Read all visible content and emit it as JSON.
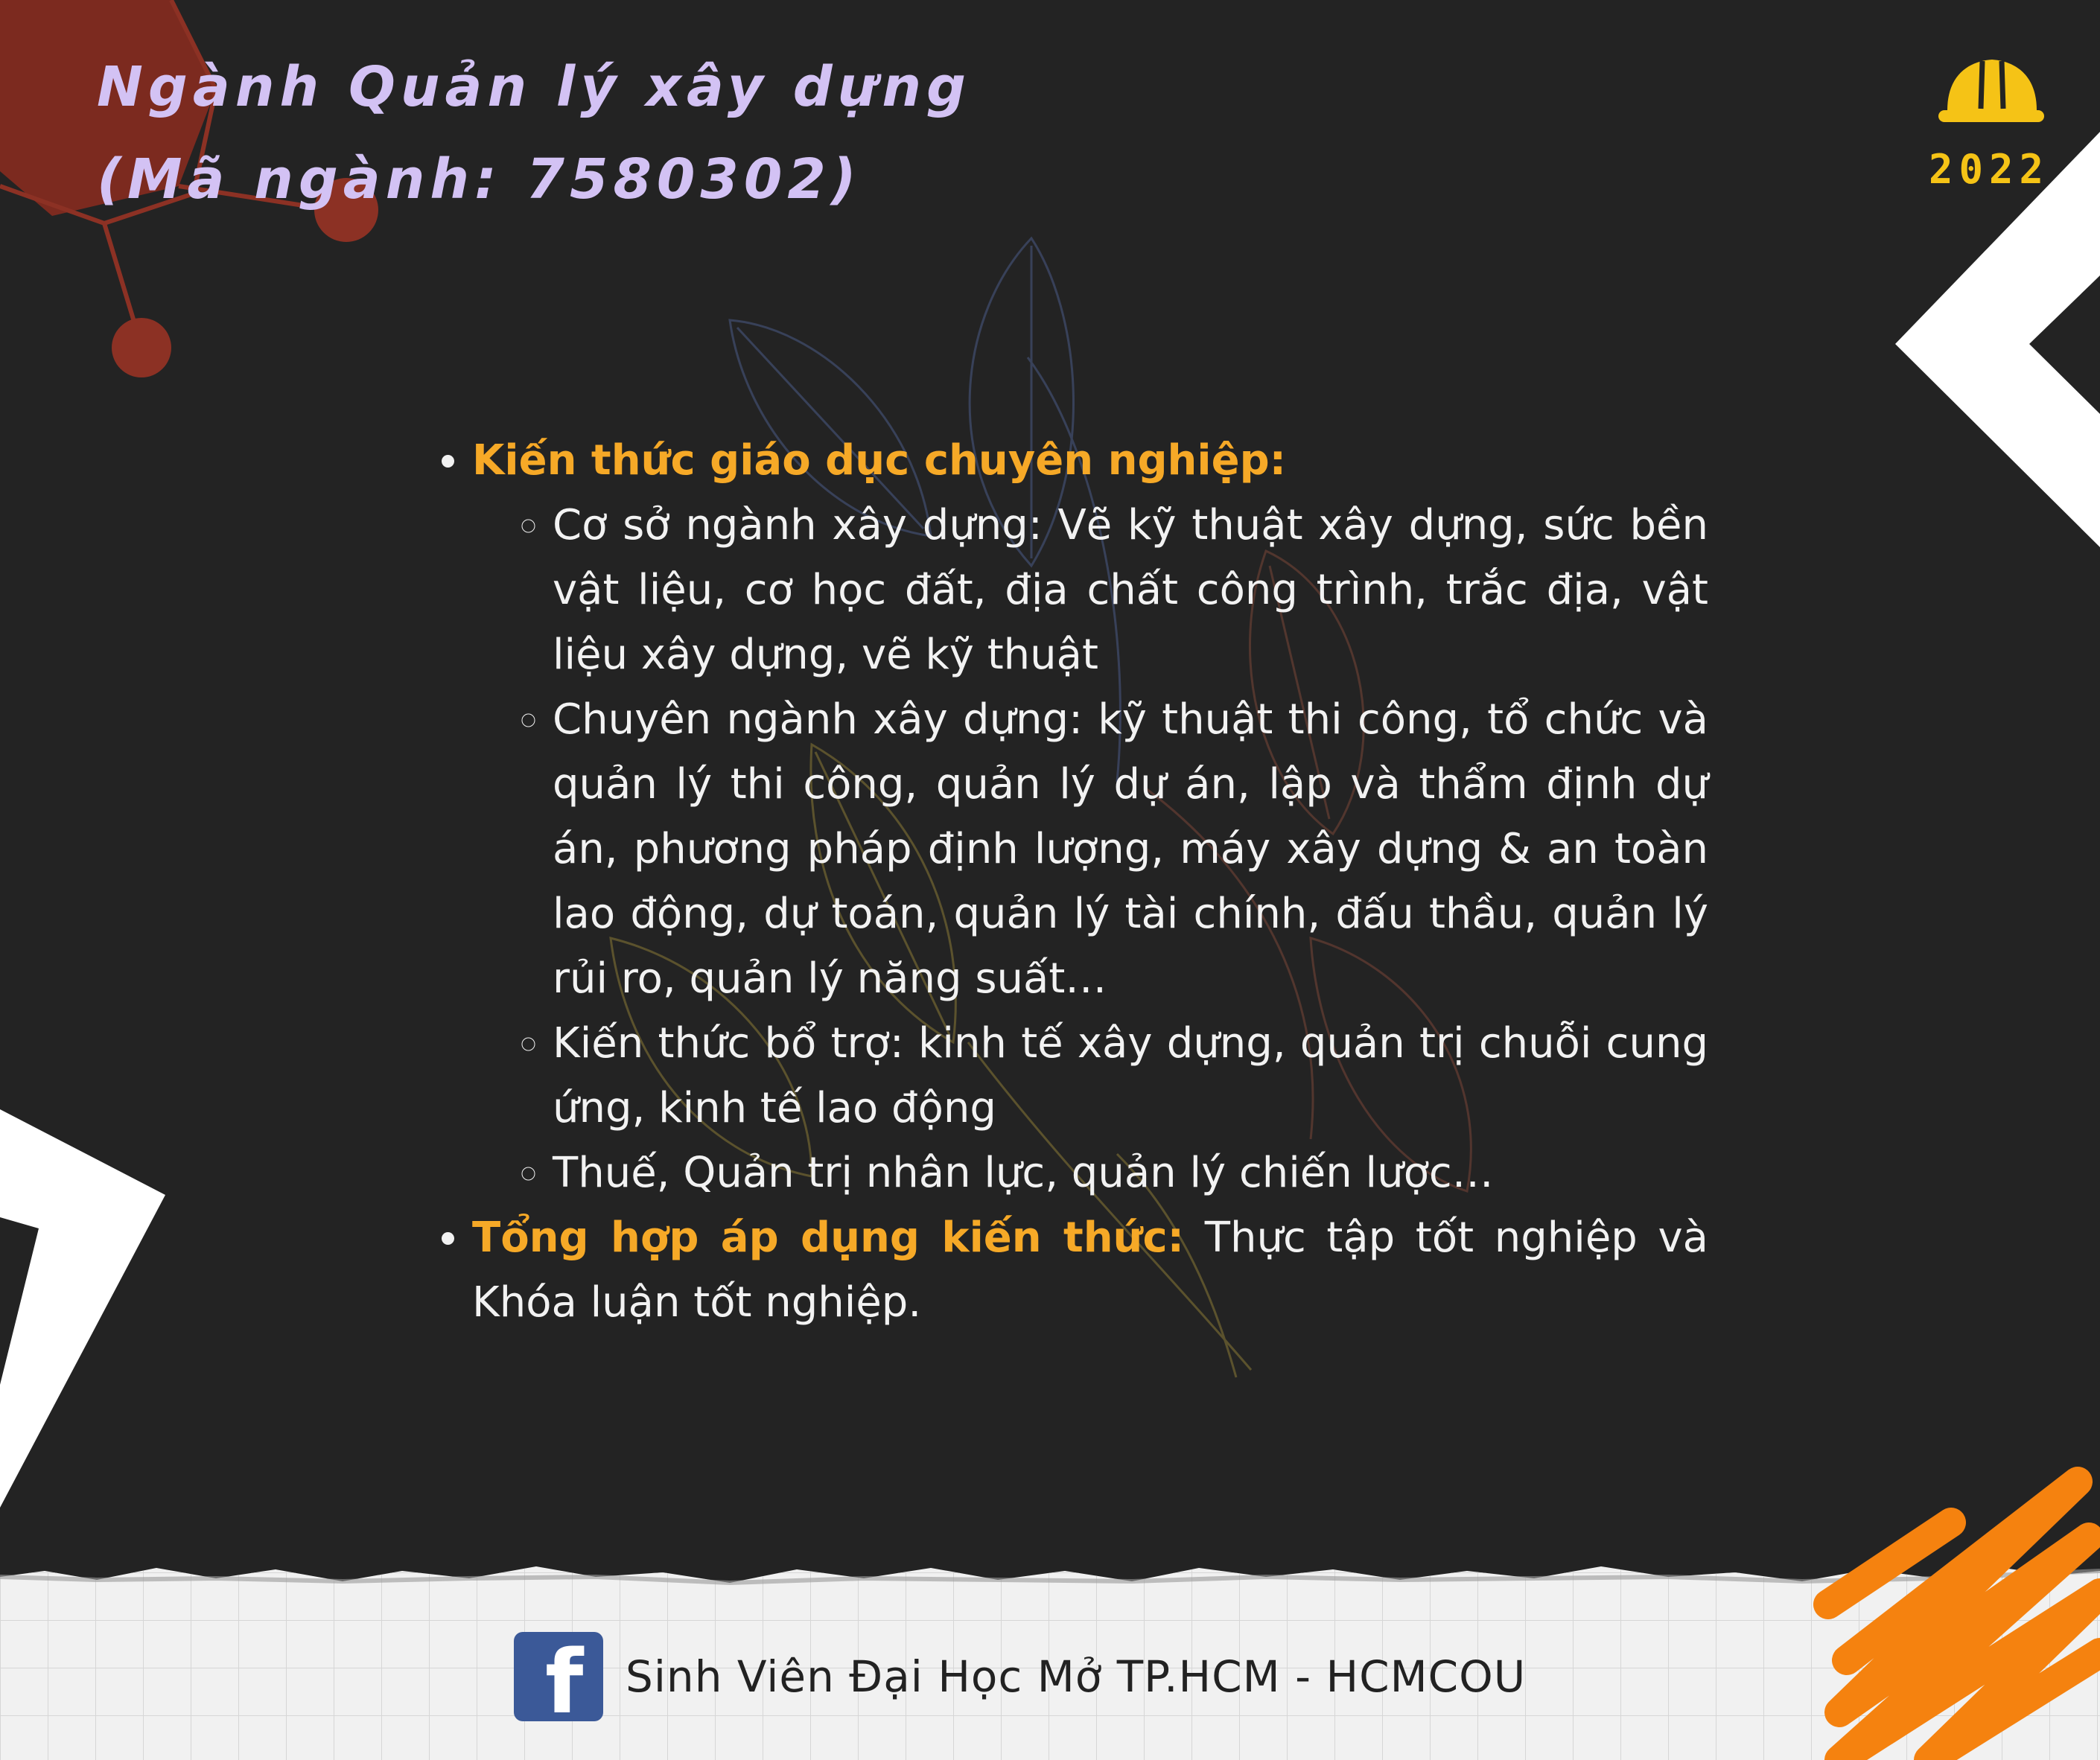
{
  "header": {
    "title_line1": "Ngành Quản lý xây dựng",
    "title_line2": "(Mã ngành: 7580302)",
    "year": "2022"
  },
  "content": {
    "sections": [
      {
        "heading": "Kiến thức giáo dục chuyên nghiệp:",
        "items": [
          "Cơ sở ngành xây dựng: Vẽ kỹ thuật xây dựng, sức bền vật liệu, cơ học đất, địa chất công trình, trắc địa, vật liệu xây dựng, vẽ kỹ thuật",
          "Chuyên ngành xây dựng: kỹ thuật thi công, tổ chức và quản lý thi công, quản lý dự án, lập và thẩm định dự án, phương pháp định lượng, máy xây dựng & an toàn lao động, dự toán, quản lý tài chính, đấu thầu, quản lý rủi ro, quản lý năng suất…",
          "Kiến thức bổ trợ: kinh tế xây dựng, quản trị chuỗi cung ứng, kinh tế lao động",
          "Thuế, Quản trị nhân lực, quản lý chiến lược…"
        ]
      },
      {
        "heading": "Tổng hợp áp dụng kiến thức:",
        "text": " Thực tập tốt nghiệp và Khóa luận tốt nghiệp."
      }
    ]
  },
  "footer": {
    "icon": "facebook-icon",
    "text": "Sinh Viên Đại Học Mở TP.HCM - HCMCOU"
  },
  "colors": {
    "background": "#232323",
    "title": "#d3c2f4",
    "highlight": "#f6a927",
    "year": "#f5c316",
    "hexagon": "#7c2a1f",
    "orange_scribble": "#f5820f",
    "facebook": "#3b5998"
  }
}
